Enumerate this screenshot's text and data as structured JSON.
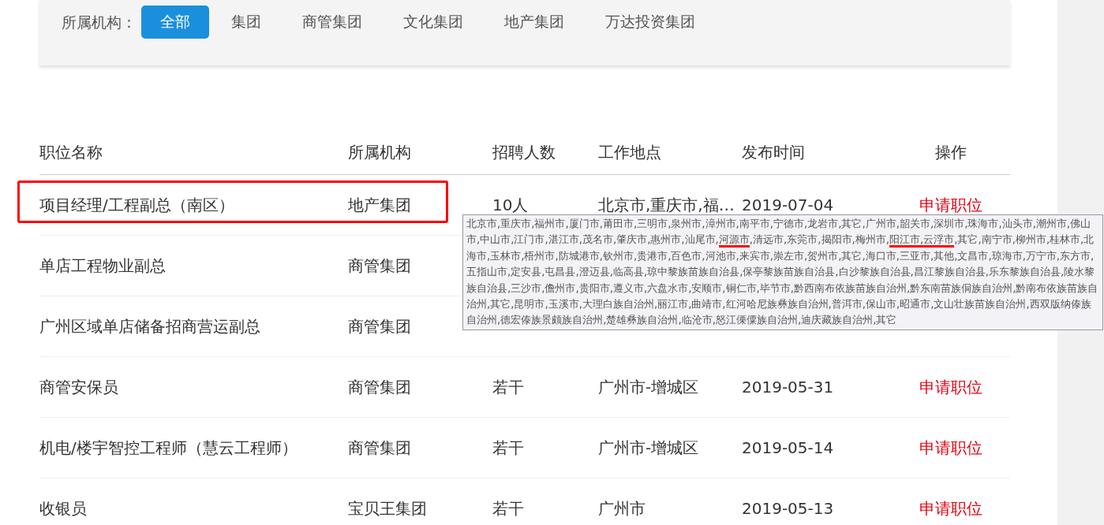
{
  "filter": {
    "label": "所属机构：",
    "options": [
      {
        "label": "全部",
        "selected": true
      },
      {
        "label": "集团",
        "selected": false
      },
      {
        "label": "商管集团",
        "selected": false
      },
      {
        "label": "文化集团",
        "selected": false
      },
      {
        "label": "地产集团",
        "selected": false
      },
      {
        "label": "万达投资集团",
        "selected": false
      }
    ]
  },
  "table": {
    "columns": [
      "职位名称",
      "所属机构",
      "招聘人数",
      "工作地点",
      "发布时间",
      "操作"
    ],
    "rows": [
      {
        "title": "项目经理/工程副总（南区）",
        "org": "地产集团",
        "count": "10人",
        "location": "北京市,重庆市,福…",
        "date": "2019-07-04",
        "action": "申请职位",
        "highlighted": true
      },
      {
        "title": "单店工程物业副总",
        "org": "商管集团",
        "highlighted": false
      },
      {
        "title": "广州区域单店储备招商营运副总",
        "org": "商管集团",
        "highlighted": false
      },
      {
        "title": "商管安保员",
        "org": "商管集团",
        "count": "若干",
        "location": "广州市-增城区",
        "date": "2019-05-31",
        "action": "申请职位",
        "highlighted": false
      },
      {
        "title": "机电/楼宇智控工程师（慧云工程师）",
        "org": "商管集团",
        "count": "若干",
        "location": "广州市-增城区",
        "date": "2019-05-14",
        "action": "申请职位",
        "highlighted": false
      },
      {
        "title": "收银员",
        "org": "宝贝王集团",
        "count": "若干",
        "location": "广州市",
        "date": "2019-05-13",
        "action": "申请职位",
        "highlighted": false
      }
    ]
  },
  "tooltip": {
    "segments": [
      {
        "text": "北京市,重庆市,福州市,厦门市,莆田市,三明市,泉州市,漳州市,南平市,宁德市,龙岩市,其它,广州市,韶关市,深圳市,珠海市,汕头市,潮州市,佛山市,中山市,江门市,湛江市,茂名市,肇庆市,惠州市,汕尾市,",
        "marked": false
      },
      {
        "text": "河源市",
        "marked": true
      },
      {
        "text": ",清远市,东莞市,揭阳市,梅州市,",
        "marked": false
      },
      {
        "text": "阳江市,云浮市",
        "marked": true
      },
      {
        "text": ",其它,南宁市,柳州市,桂林市,北海市,玉林市,梧州市,防城港市,钦州市,贵港市,百色市,河池市,来宾市,崇左市,贺州市,其它,海口市,三亚市,其他,文昌市,琼海市,万宁市,东方市,五指山市,定安县,屯昌县,澄迈县,临高县,琼中黎族苗族自治县,保亭黎族苗族自治县,白沙黎族自治县,昌江黎族自治县,乐东黎族自治县,陵水黎族自治县,三沙市,儋州市,贵阳市,遵义市,六盘水市,安顺市,铜仁市,毕节市,黔西南布依族苗族自治州,黔东南苗族侗族自治州,黔南布依族苗族自治州,其它,昆明市,玉溪市,大理白族自治州,丽江市,曲靖市,红河哈尼族彝族自治州,普洱市,保山市,昭通市,文山壮族苗族自治州,西双版纳傣族自治州,德宏傣族景颇族自治州,楚雄彝族自治州,临沧市,怒江傈僳族自治州,迪庆藏族自治州,其它",
        "marked": false
      }
    ]
  }
}
